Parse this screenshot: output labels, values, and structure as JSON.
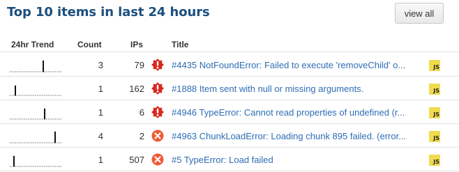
{
  "panel": {
    "title": "Top 10 items in last 24 hours",
    "view_all_label": "view all"
  },
  "columns": {
    "trend": "24hr Trend",
    "count": "Count",
    "ips": "IPs",
    "title": "Title"
  },
  "items": [
    {
      "count": "3",
      "ips": "79",
      "level": "warning",
      "level_icon": "burst-exclamation-icon",
      "title": "#4435 NotFoundError: Failed to execute 'removeChild' o...",
      "platform": "JS",
      "trend_spike": 0.65,
      "trend_height": 0.85
    },
    {
      "count": "1",
      "ips": "162",
      "level": "warning",
      "level_icon": "burst-exclamation-icon",
      "title": "#1888 Item sent with null or missing arguments.",
      "platform": "JS",
      "trend_spike": 0.08,
      "trend_height": 0.75
    },
    {
      "count": "1",
      "ips": "6",
      "level": "warning",
      "level_icon": "burst-exclamation-icon",
      "title": "#4946 TypeError: Cannot read properties of undefined (r...",
      "platform": "JS",
      "trend_spike": 0.68,
      "trend_height": 0.8
    },
    {
      "count": "4",
      "ips": "2",
      "level": "error",
      "level_icon": "circle-x-icon",
      "title": "#4963 ChunkLoadError: Loading chunk 895 failed. (error...",
      "platform": "JS",
      "trend_spike": 0.9,
      "trend_height": 0.85
    },
    {
      "count": "1",
      "ips": "507",
      "level": "error",
      "level_icon": "circle-x-icon",
      "title": "#5 TypeError: Load failed",
      "platform": "JS",
      "trend_spike": 0.05,
      "trend_height": 0.8
    }
  ],
  "colors": {
    "title": "#1c4f7e",
    "link": "#2e6db4",
    "warning": "#d9281d",
    "error": "#ef5b35",
    "js_badge": "#f0db4f"
  }
}
